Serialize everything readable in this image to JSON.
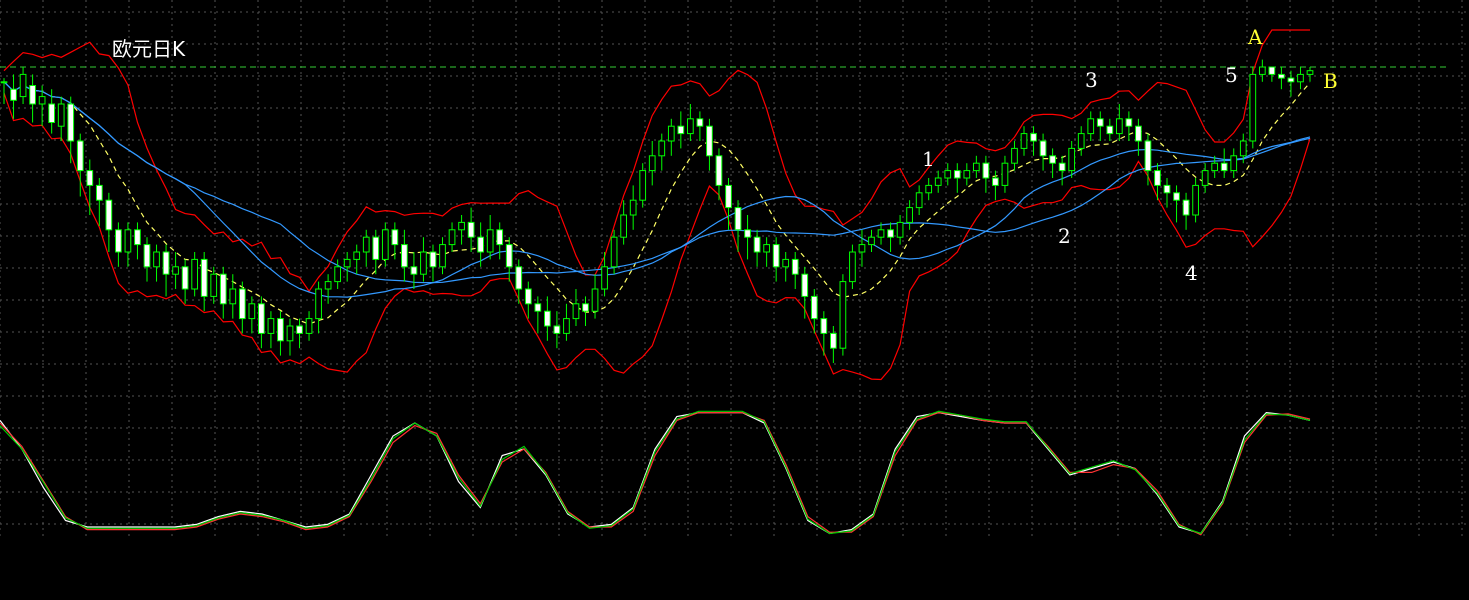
{
  "chart_data": {
    "type": "candlestick",
    "title": "欧元日K",
    "grid": true,
    "price_panel": {
      "ylim": [
        0,
        100
      ],
      "resistance_level": 90,
      "candles": [
        [
          86,
          86,
          80,
          87
        ],
        [
          84,
          81,
          76,
          88
        ],
        [
          82,
          88,
          80,
          90
        ],
        [
          85,
          80,
          75,
          88
        ],
        [
          80,
          82,
          74,
          85
        ],
        [
          80,
          75,
          72,
          84
        ],
        [
          74,
          80,
          70,
          82
        ],
        [
          80,
          70,
          64,
          82
        ],
        [
          70,
          62,
          55,
          72
        ],
        [
          62,
          58,
          50,
          65
        ],
        [
          58,
          54,
          47,
          60
        ],
        [
          54,
          46,
          40,
          56
        ],
        [
          46,
          40,
          36,
          48
        ],
        [
          40,
          46,
          36,
          48
        ],
        [
          46,
          42,
          38,
          48
        ],
        [
          42,
          36,
          32,
          44
        ],
        [
          36,
          40,
          32,
          42
        ],
        [
          40,
          34,
          28,
          42
        ],
        [
          34,
          36,
          30,
          40
        ],
        [
          36,
          30,
          26,
          38
        ],
        [
          30,
          38,
          28,
          40
        ],
        [
          38,
          28,
          24,
          40
        ],
        [
          28,
          34,
          26,
          36
        ],
        [
          34,
          26,
          22,
          36
        ],
        [
          26,
          30,
          22,
          34
        ],
        [
          30,
          22,
          18,
          32
        ],
        [
          22,
          26,
          18,
          28
        ],
        [
          26,
          18,
          14,
          28
        ],
        [
          18,
          22,
          14,
          24
        ],
        [
          22,
          16,
          12,
          24
        ],
        [
          16,
          20,
          12,
          22
        ],
        [
          20,
          18,
          14,
          22
        ],
        [
          18,
          22,
          16,
          24
        ],
        [
          22,
          30,
          18,
          32
        ],
        [
          30,
          32,
          26,
          34
        ],
        [
          32,
          36,
          30,
          38
        ],
        [
          36,
          38,
          32,
          40
        ],
        [
          38,
          40,
          34,
          42
        ],
        [
          40,
          44,
          36,
          46
        ],
        [
          44,
          38,
          34,
          46
        ],
        [
          38,
          46,
          36,
          48
        ],
        [
          46,
          42,
          38,
          48
        ],
        [
          42,
          36,
          32,
          46
        ],
        [
          36,
          34,
          30,
          40
        ],
        [
          34,
          40,
          32,
          44
        ],
        [
          40,
          36,
          32,
          42
        ],
        [
          36,
          42,
          34,
          44
        ],
        [
          42,
          46,
          40,
          48
        ],
        [
          46,
          48,
          42,
          50
        ],
        [
          48,
          44,
          40,
          52
        ],
        [
          44,
          40,
          36,
          48
        ],
        [
          40,
          46,
          38,
          50
        ],
        [
          46,
          42,
          38,
          48
        ],
        [
          42,
          36,
          32,
          44
        ],
        [
          36,
          30,
          26,
          38
        ],
        [
          30,
          26,
          22,
          32
        ],
        [
          26,
          24,
          18,
          28
        ],
        [
          24,
          20,
          16,
          28
        ],
        [
          20,
          18,
          14,
          24
        ],
        [
          18,
          22,
          16,
          26
        ],
        [
          22,
          26,
          20,
          30
        ],
        [
          26,
          24,
          20,
          28
        ],
        [
          24,
          30,
          22,
          34
        ],
        [
          30,
          36,
          28,
          40
        ],
        [
          36,
          44,
          34,
          46
        ],
        [
          44,
          50,
          42,
          54
        ],
        [
          50,
          54,
          46,
          58
        ],
        [
          54,
          62,
          52,
          64
        ],
        [
          62,
          66,
          58,
          70
        ],
        [
          66,
          70,
          62,
          72
        ],
        [
          70,
          74,
          66,
          76
        ],
        [
          74,
          72,
          68,
          78
        ],
        [
          72,
          76,
          70,
          80
        ],
        [
          76,
          74,
          70,
          78
        ],
        [
          74,
          66,
          62,
          76
        ],
        [
          66,
          58,
          54,
          68
        ],
        [
          58,
          52,
          46,
          60
        ],
        [
          52,
          46,
          40,
          54
        ],
        [
          46,
          44,
          38,
          50
        ],
        [
          44,
          40,
          36,
          46
        ],
        [
          40,
          42,
          36,
          44
        ],
        [
          42,
          36,
          32,
          44
        ],
        [
          36,
          38,
          32,
          40
        ],
        [
          38,
          34,
          30,
          40
        ],
        [
          34,
          28,
          22,
          36
        ],
        [
          28,
          22,
          18,
          30
        ],
        [
          22,
          18,
          12,
          24
        ],
        [
          18,
          14,
          10,
          20
        ],
        [
          14,
          32,
          12,
          34
        ],
        [
          32,
          40,
          30,
          42
        ],
        [
          40,
          42,
          36,
          46
        ],
        [
          42,
          44,
          40,
          46
        ],
        [
          44,
          46,
          42,
          48
        ],
        [
          46,
          44,
          40,
          48
        ],
        [
          44,
          48,
          42,
          50
        ],
        [
          48,
          52,
          46,
          54
        ],
        [
          52,
          56,
          50,
          58
        ],
        [
          56,
          58,
          54,
          60
        ],
        [
          58,
          60,
          56,
          62
        ],
        [
          60,
          62,
          58,
          64
        ],
        [
          62,
          60,
          56,
          64
        ],
        [
          60,
          62,
          58,
          64
        ],
        [
          62,
          64,
          60,
          66
        ],
        [
          64,
          60,
          56,
          66
        ],
        [
          60,
          58,
          54,
          62
        ],
        [
          58,
          64,
          56,
          66
        ],
        [
          64,
          68,
          62,
          70
        ],
        [
          68,
          72,
          66,
          74
        ],
        [
          72,
          70,
          66,
          74
        ],
        [
          70,
          66,
          62,
          72
        ],
        [
          66,
          64,
          60,
          68
        ],
        [
          64,
          62,
          58,
          66
        ],
        [
          62,
          68,
          60,
          70
        ],
        [
          68,
          72,
          66,
          74
        ],
        [
          72,
          76,
          70,
          78
        ],
        [
          76,
          74,
          70,
          78
        ],
        [
          74,
          72,
          70,
          76
        ],
        [
          72,
          76,
          70,
          80
        ],
        [
          76,
          74,
          70,
          78
        ],
        [
          74,
          70,
          66,
          76
        ],
        [
          70,
          62,
          58,
          72
        ],
        [
          62,
          58,
          54,
          64
        ],
        [
          58,
          56,
          52,
          60
        ],
        [
          56,
          54,
          48,
          58
        ],
        [
          54,
          50,
          46,
          56
        ],
        [
          50,
          58,
          48,
          60
        ],
        [
          58,
          62,
          56,
          64
        ],
        [
          62,
          64,
          60,
          66
        ],
        [
          64,
          62,
          60,
          68
        ],
        [
          62,
          66,
          60,
          68
        ],
        [
          66,
          70,
          64,
          72
        ],
        [
          70,
          88,
          68,
          90
        ],
        [
          88,
          90,
          86,
          92
        ],
        [
          90,
          88,
          86,
          90
        ],
        [
          88,
          87,
          84,
          90
        ],
        [
          87,
          86,
          82,
          89
        ],
        [
          86,
          88,
          84,
          90
        ],
        [
          88,
          89,
          86,
          90
        ]
      ],
      "labels": [
        {
          "text": "1",
          "color": "#ffffff"
        },
        {
          "text": "2",
          "color": "#ffffff"
        },
        {
          "text": "3",
          "color": "#ffffff"
        },
        {
          "text": "4",
          "color": "#ffffff"
        },
        {
          "text": "5",
          "color": "#ffffff"
        },
        {
          "text": "A",
          "color": "#ffff33"
        },
        {
          "text": "B",
          "color": "#ffff33"
        }
      ]
    },
    "oscillator_panel": {
      "ylim": [
        0,
        100
      ],
      "series": [
        {
          "color": "#ffffff",
          "values": [
            92,
            70,
            40,
            15,
            10,
            10,
            10,
            10,
            10,
            12,
            18,
            22,
            20,
            15,
            10,
            12,
            20,
            50,
            80,
            90,
            80,
            45,
            25,
            65,
            70,
            50,
            20,
            10,
            12,
            25,
            70,
            95,
            98,
            98,
            98,
            90,
            55,
            15,
            5,
            8,
            20,
            70,
            95,
            98,
            95,
            92,
            90,
            90,
            70,
            50,
            55,
            60,
            55,
            35,
            10,
            5,
            30,
            80,
            98,
            96,
            92
          ]
        },
        {
          "color": "#ff3333",
          "values": [
            90,
            72,
            45,
            18,
            8,
            8,
            8,
            8,
            8,
            10,
            16,
            20,
            18,
            14,
            8,
            10,
            18,
            45,
            75,
            88,
            82,
            50,
            28,
            60,
            70,
            52,
            22,
            10,
            10,
            22,
            65,
            92,
            98,
            98,
            98,
            92,
            58,
            18,
            6,
            6,
            18,
            65,
            92,
            98,
            96,
            92,
            90,
            90,
            72,
            52,
            52,
            58,
            55,
            38,
            12,
            4,
            28,
            75,
            96,
            97,
            93
          ]
        },
        {
          "color": "#00cc00",
          "values": [
            88,
            70,
            44,
            17,
            9,
            9,
            9,
            9,
            9,
            11,
            17,
            21,
            19,
            15,
            9,
            11,
            19,
            47,
            78,
            90,
            80,
            48,
            26,
            62,
            72,
            51,
            21,
            9,
            11,
            24,
            68,
            93,
            99,
            99,
            99,
            91,
            56,
            16,
            5,
            7,
            19,
            68,
            93,
            99,
            96,
            93,
            91,
            91,
            71,
            51,
            56,
            61,
            54,
            36,
            11,
            5,
            29,
            77,
            97,
            96,
            92
          ]
        }
      ]
    },
    "colors": {
      "bull": "#00ff00",
      "bear_body": "#ffffff",
      "bull_body": "#000000",
      "bollinger": "#ff0000",
      "ma_blue": "#3399ff",
      "ma_dashed": "#ffff66",
      "resistance": "#33cc33",
      "grid": "#555555"
    }
  }
}
